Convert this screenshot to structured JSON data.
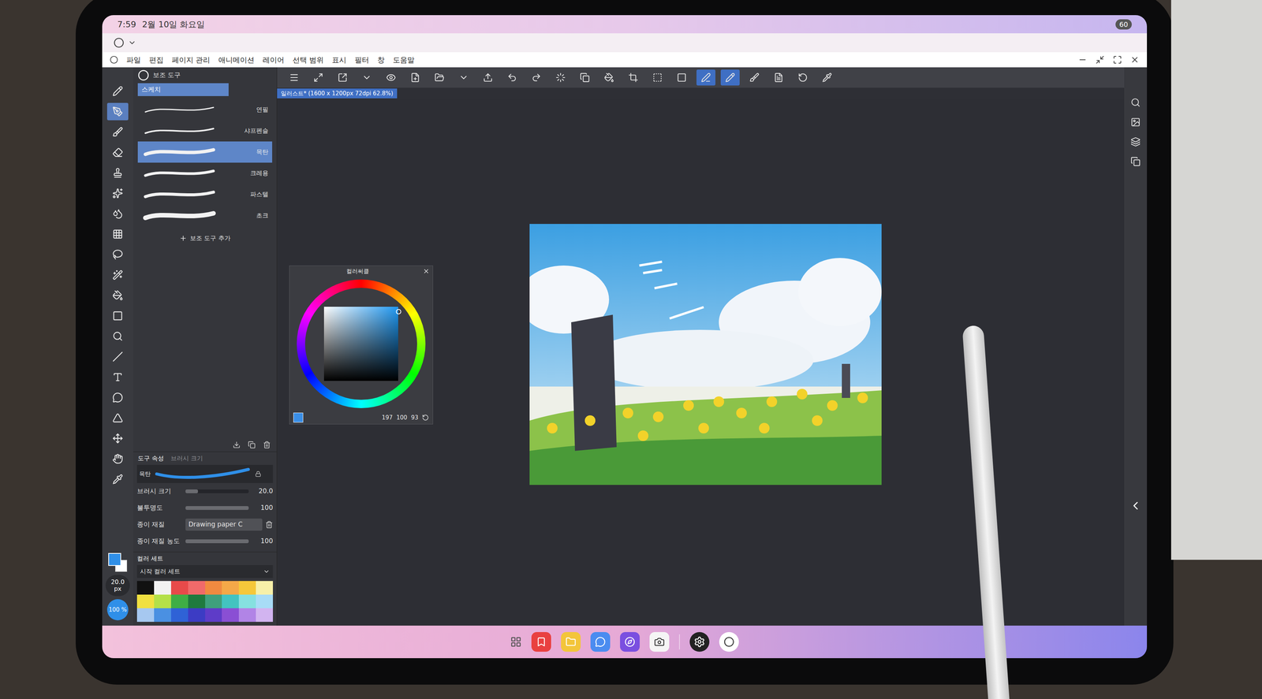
{
  "status_bar": {
    "time": "7:59",
    "date": "2월 10일 화요일",
    "battery": "60"
  },
  "menu": [
    "파일",
    "편집",
    "페이지 관리",
    "애니메이션",
    "레이어",
    "선택 범위",
    "표시",
    "필터",
    "창",
    "도움말"
  ],
  "toolbar": [
    {
      "selected": false
    },
    {
      "selected": false
    },
    {
      "selected": false
    },
    {
      "selected": false
    },
    {
      "selected": false
    },
    {
      "selected": false
    },
    {
      "selected": false
    },
    {
      "selected": false
    },
    {
      "selected": false
    },
    {
      "selected": false
    },
    {
      "selected": false
    },
    {
      "selected": false
    },
    {
      "selected": false
    },
    {
      "selected": false
    },
    {
      "selected": false
    },
    {
      "selected": false
    },
    {
      "selected": false
    },
    {
      "selected": true
    },
    {
      "selected": true
    },
    {
      "selected": false
    },
    {
      "selected": false
    },
    {
      "selected": false
    },
    {
      "selected": false
    }
  ],
  "tools": [
    {
      "selected": false
    },
    {
      "selected": true
    },
    {
      "selected": false
    },
    {
      "selected": false
    },
    {
      "selected": false
    },
    {
      "selected": false
    },
    {
      "selected": false
    },
    {
      "selected": false
    },
    {
      "selected": false
    },
    {
      "selected": false
    },
    {
      "selected": false
    },
    {
      "selected": false
    },
    {
      "selected": false
    },
    {
      "selected": false
    },
    {
      "selected": false
    },
    {
      "selected": false
    },
    {
      "selected": false
    },
    {
      "selected": false
    },
    {
      "selected": false
    },
    {
      "selected": false
    }
  ],
  "tool_colors": {
    "main": "#2f8fe8",
    "sub": "#ffffff"
  },
  "tool_status": {
    "size": "20.0 px",
    "opacity": "100 %"
  },
  "sub_tool": {
    "title": "보조 도구",
    "group": "스케치",
    "add": "보조 도구 추가",
    "items": [
      {
        "label": "연필",
        "selected": false
      },
      {
        "label": "샤프펜슬",
        "selected": false
      },
      {
        "label": "목탄",
        "selected": true
      },
      {
        "label": "크레용",
        "selected": false
      },
      {
        "label": "파스텔",
        "selected": false
      },
      {
        "label": "초크",
        "selected": false
      }
    ]
  },
  "tool_property": {
    "tabs": [
      {
        "label": "도구 속성",
        "selected": true
      },
      {
        "label": "브러시 크기",
        "selected": false
      }
    ],
    "brush": "목탄",
    "rows": [
      {
        "kind": "slider",
        "label": "브러시 크기",
        "value": "20.0",
        "level": 0.2
      },
      {
        "kind": "slider",
        "label": "불투명도",
        "value": "100",
        "level": 1
      },
      {
        "kind": "field",
        "label": "종이 재질",
        "value": "Drawing paper C"
      },
      {
        "kind": "slider",
        "label": "종이 재질 농도",
        "value": "100",
        "level": 1
      }
    ]
  },
  "color_set": {
    "title": "컬러 세트",
    "set": "시작 컬러 세트",
    "swatches": [
      {
        "color": "#111111"
      },
      {
        "color": "#f2f2f2"
      },
      {
        "color": "#e84a4a"
      },
      {
        "color": "#f06a6a"
      },
      {
        "color": "#f08a40"
      },
      {
        "color": "#f4a848"
      },
      {
        "color": "#f5c83a"
      },
      {
        "color": "#f7f0a8"
      },
      {
        "color": "#f0e040"
      },
      {
        "color": "#b4e048"
      },
      {
        "color": "#3fae45"
      },
      {
        "color": "#1f7a3e"
      },
      {
        "color": "#3fa07c"
      },
      {
        "color": "#43c3c0"
      },
      {
        "color": "#86e0e0"
      },
      {
        "color": "#a8dcf6"
      },
      {
        "color": "#a6c8f0"
      },
      {
        "color": "#4a90e2"
      },
      {
        "color": "#2f62d6"
      },
      {
        "color": "#3c3cc4"
      },
      {
        "color": "#5e3cc8"
      },
      {
        "color": "#8a4fd4"
      },
      {
        "color": "#b184e6"
      },
      {
        "color": "#d2b4f0"
      }
    ]
  },
  "canvas_tab": {
    "title": "일러스트* (1600 x 1200px 72dpi 62.8%)"
  },
  "color_circle": {
    "title": "컬러써클",
    "hue_color": "#1f97f0",
    "current": "#3a8ee6",
    "values": [
      "197",
      "100",
      "93"
    ]
  }
}
